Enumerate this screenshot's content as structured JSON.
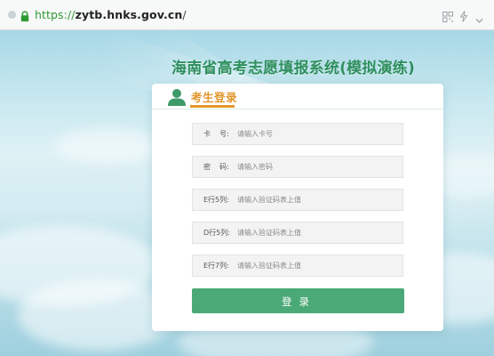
{
  "browser": {
    "url_scheme": "https://",
    "url_host": "zytb.hnks.gov.cn",
    "url_path": "/"
  },
  "page": {
    "system_title": "海南省高考志愿填报系统(模拟演练)"
  },
  "login": {
    "tab_title": "考生登录",
    "fields": [
      {
        "label": "卡    号:",
        "placeholder": "请输入卡号",
        "value": ""
      },
      {
        "label": "密    码:",
        "placeholder": "请输入密码",
        "value": ""
      },
      {
        "label": "E行5列:",
        "placeholder": "请输入验证码表上值",
        "value": ""
      },
      {
        "label": "D行5列:",
        "placeholder": "请输入验证码表上值",
        "value": ""
      },
      {
        "label": "E行7列:",
        "placeholder": "请输入验证码表上值",
        "value": ""
      }
    ],
    "submit_label": "登录"
  },
  "colors": {
    "title_green": "#2e8f5e",
    "tab_orange": "#e3962a",
    "button_green": "#4aa977",
    "user_icon_green": "#3f9a6a"
  },
  "icons": [
    "dot-icon",
    "lock-icon",
    "qr-code-icon",
    "lightning-icon",
    "chevron-down-icon",
    "user-icon"
  ]
}
